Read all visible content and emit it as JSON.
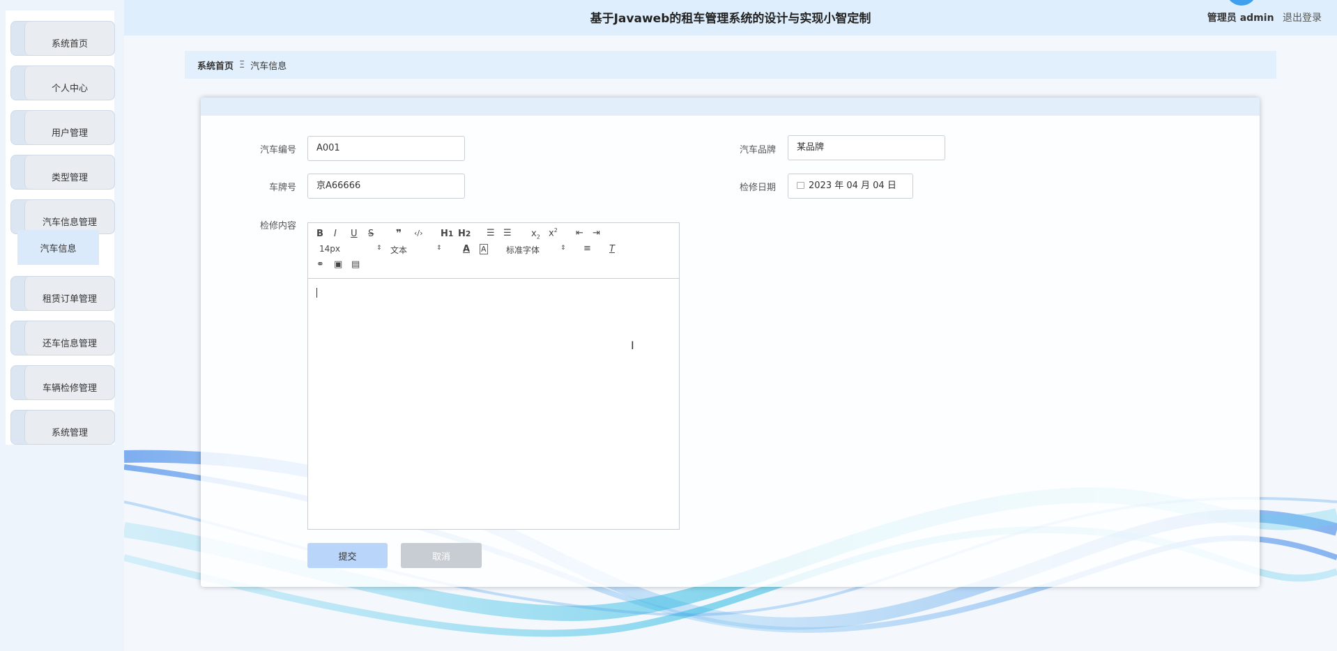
{
  "header": {
    "title": "基于Javaweb的租车管理系统的设计与实现小智定制",
    "user_label": "管理员 admin",
    "logout_label": "退出登录"
  },
  "sidebar": {
    "items": [
      {
        "label": "系统首页"
      },
      {
        "label": "个人中心"
      },
      {
        "label": "用户管理"
      },
      {
        "label": "类型管理"
      },
      {
        "label": "汽车信息管理"
      },
      {
        "label": "租赁订单管理"
      },
      {
        "label": "还车信息管理"
      },
      {
        "label": "车辆检修管理"
      },
      {
        "label": "系统管理"
      }
    ],
    "sub_item": "汽车信息"
  },
  "breadcrumb": {
    "home": "系统首页",
    "separator": "Ξ",
    "current": "汽车信息"
  },
  "form": {
    "car_no": {
      "label": "汽车编号",
      "value": "A001"
    },
    "brand": {
      "label": "汽车品牌",
      "value": "某品牌"
    },
    "plate": {
      "label": "车牌号",
      "value": "京A66666"
    },
    "date": {
      "label": "检修日期",
      "value": "2023 年 04 月 04 日"
    },
    "content": {
      "label": "检修内容"
    }
  },
  "editor": {
    "font_size": "14px",
    "text_type": "文本",
    "font_family": "标准字体"
  },
  "buttons": {
    "submit": "提交",
    "cancel": "取消"
  },
  "colors": {
    "accent": "#b9d6fa",
    "header_bg": "#dfeefc",
    "sidebar_active": "#dbeafb"
  }
}
